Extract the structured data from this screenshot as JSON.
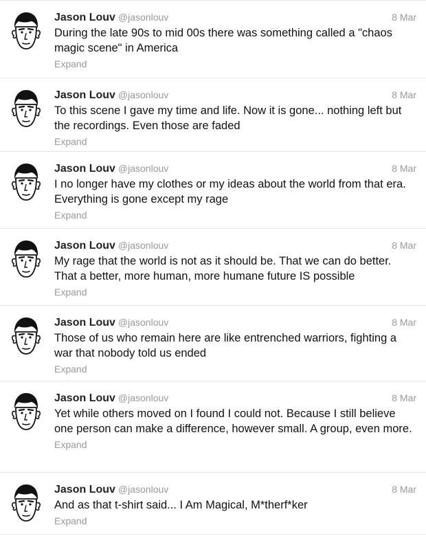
{
  "tweets": [
    {
      "name": "Jason Louv",
      "handle": "@jasonlouv",
      "date": "8 Mar",
      "text": "During the late 90s to mid 00s there was something called a \"chaos magic scene\" in America",
      "expand_label": "Expand"
    },
    {
      "name": "Jason Louv",
      "handle": "@jasonlouv",
      "date": "8 Mar",
      "text": "To this scene I gave my time and life. Now it is gone... nothing left but the recordings. Even those are faded",
      "expand_label": "Expand"
    },
    {
      "name": "Jason Louv",
      "handle": "@jasonlouv",
      "date": "8 Mar",
      "text": "I no longer have my clothes or my ideas about the world from that era. Everything is gone except my rage",
      "expand_label": "Expand"
    },
    {
      "name": "Jason Louv",
      "handle": "@jasonlouv",
      "date": "8 Mar",
      "text": "My rage that the world is not as it should be. That we can do better. That a better, more human, more humane future IS possible",
      "expand_label": "Expand"
    },
    {
      "name": "Jason Louv",
      "handle": "@jasonlouv",
      "date": "8 Mar",
      "text": "Those of us who remain here are like entrenched warriors, fighting a war that nobody told us ended",
      "expand_label": "Expand"
    },
    {
      "name": "Jason Louv",
      "handle": "@jasonlouv",
      "date": "8 Mar",
      "text": "Yet while others moved on I found I could not. Because I still believe one person can make a difference, however small. A group, even more.",
      "expand_label": "Expand"
    },
    {
      "name": "Jason Louv",
      "handle": "@jasonlouv",
      "date": "8 Mar",
      "text": "And as that t-shirt said... I Am Magical, M*therf*ker",
      "expand_label": "Expand"
    }
  ]
}
